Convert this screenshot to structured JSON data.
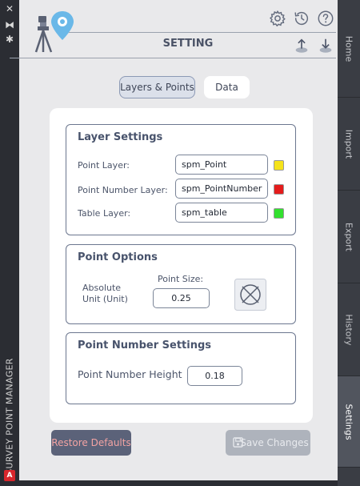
{
  "left_strip": {
    "close_glyph": "✕",
    "pin_glyph": "⧓",
    "settings_glyph": "✱",
    "panel_title": "SURVEY POINT MANAGER",
    "app_badge": "A"
  },
  "right_tabs": [
    {
      "label": "Home",
      "active": false
    },
    {
      "label": "Import",
      "active": false
    },
    {
      "label": "Export",
      "active": false
    },
    {
      "label": "History",
      "active": false
    },
    {
      "label": "Settings",
      "active": true
    }
  ],
  "header": {
    "title": "SETTING",
    "icons": [
      "gear-icon",
      "history-icon",
      "help-icon",
      "upload-icon",
      "download-icon"
    ]
  },
  "toggle": {
    "layers_points": "Layers & Points",
    "data": "Data",
    "active": "Layers & Points"
  },
  "layer_settings": {
    "title": "Layer Settings",
    "rows": [
      {
        "label": "Point Layer:",
        "value": "spm_Point",
        "color": "#f5e31b"
      },
      {
        "label": "Point Number Layer:",
        "value": "spm_PointNumber",
        "color": "#e41b1b"
      },
      {
        "label": "Table Layer:",
        "value": "spm_table",
        "color": "#33e02f"
      }
    ]
  },
  "point_options": {
    "title": "Point Options",
    "unit_label_line1": "Absolute",
    "unit_label_line2": "Unit (Unit)",
    "size_label": "Point Size:",
    "size_value": "0.25",
    "style_icon": "point-style-icon"
  },
  "point_number_settings": {
    "title": "Point Number Settings",
    "height_label": "Point Number Height",
    "height_value": "0.18"
  },
  "actions": {
    "restore": "Restore Defaults",
    "save": "Save Changes"
  }
}
